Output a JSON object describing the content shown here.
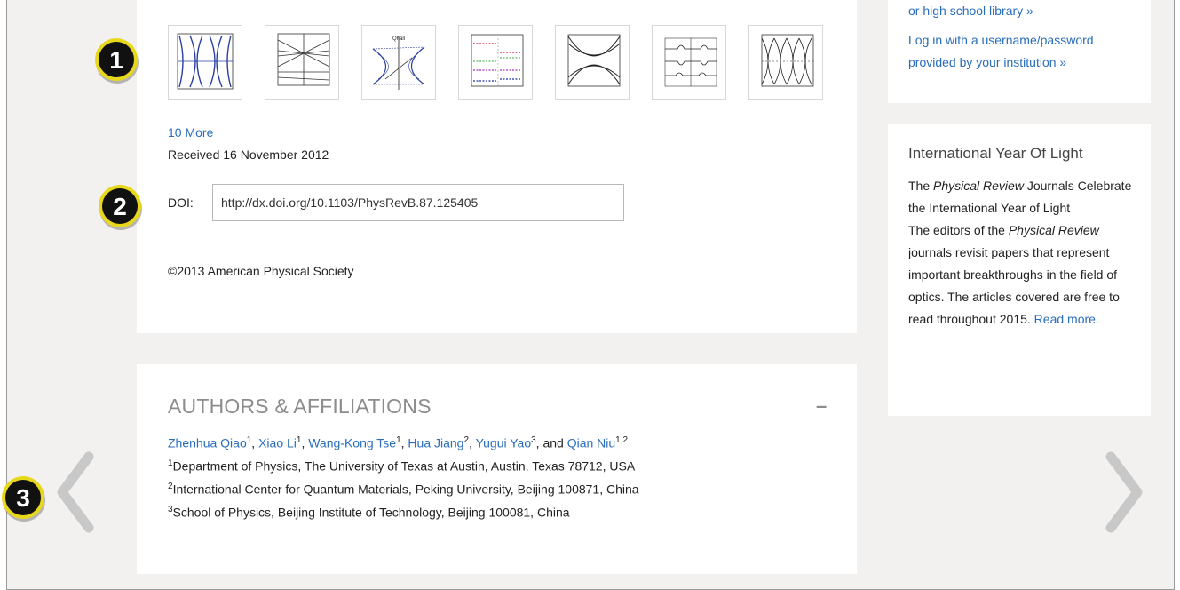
{
  "figures": {
    "thumbnails": [
      {
        "name": "figure-1-thumbnail"
      },
      {
        "name": "figure-2-thumbnail"
      },
      {
        "name": "figure-3-thumbnail",
        "label": "Qhall"
      },
      {
        "name": "figure-4-thumbnail"
      },
      {
        "name": "figure-5-thumbnail"
      },
      {
        "name": "figure-6-thumbnail"
      },
      {
        "name": "figure-7-thumbnail"
      }
    ],
    "more_link": "10 More"
  },
  "article": {
    "received": "Received 16 November 2012",
    "doi_label": "DOI:",
    "doi_value": "http://dx.doi.org/10.1103/PhysRevB.87.125405",
    "copyright": "©2013 American Physical Society"
  },
  "authors_section": {
    "heading": "AUTHORS & AFFILIATIONS",
    "collapse_symbol": "–",
    "authors": [
      {
        "name": "Zhenhua Qiao",
        "sup": "1",
        "sep": ", "
      },
      {
        "name": "Xiao Li",
        "sup": "1",
        "sep": ", "
      },
      {
        "name": "Wang-Kong Tse",
        "sup": "1",
        "sep": ", "
      },
      {
        "name": "Hua Jiang",
        "sup": "2",
        "sep": ", "
      },
      {
        "name": "Yugui Yao",
        "sup": "3",
        "sep": ", and "
      },
      {
        "name": "Qian Niu",
        "sup": "1,2",
        "sep": ""
      }
    ],
    "affiliations": [
      {
        "sup": "1",
        "text": "Department of Physics, The University of Texas at Austin, Austin, Texas 78712, USA"
      },
      {
        "sup": "2",
        "text": "International Center for Quantum Materials, Peking University, Beijing 100871, China"
      },
      {
        "sup": "3",
        "text": "School of Physics, Beijing Institute of Technology, Beijing 100081, China"
      }
    ]
  },
  "sidebar": {
    "library": {
      "line1": "or high school library »",
      "line2": "Log in with a username/password",
      "line3": "provided by your institution »"
    },
    "iyl": {
      "title": "International Year Of Light",
      "p1_pre": "The ",
      "p1_em": "Physical Review",
      "p1_post": " Journals Celebrate the International Year of Light",
      "p2_pre": "The editors of the ",
      "p2_em": "Physical Review",
      "p2_post": " journals revisit papers that represent important breakthroughs in the field of optics. The articles covered are free to read throughout 2015. ",
      "read_more": "Read more."
    }
  },
  "callouts": [
    "1",
    "2",
    "3"
  ],
  "colors": {
    "link": "#2a6ebb",
    "page_bg": "#f2f1ef",
    "badge_fill": "#111111",
    "badge_ring": "#e8d81c",
    "arrow": "#c8c8c8"
  },
  "icons": {
    "prev": "chevron-left-icon",
    "next": "chevron-right-icon"
  }
}
